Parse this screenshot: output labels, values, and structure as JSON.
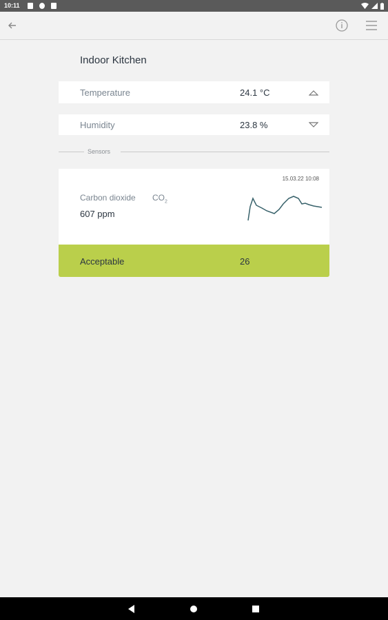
{
  "status_bar": {
    "time": "10:11",
    "left_icons": [
      "notification-icon",
      "sync-icon",
      "sd-card-icon"
    ],
    "right_icons": [
      "wifi-icon",
      "signal-icon",
      "battery-icon"
    ]
  },
  "toolbar": {
    "back_icon": "back-arrow-icon",
    "info_icon": "info-icon",
    "menu_icon": "menu-icon"
  },
  "page": {
    "title": "Indoor Kitchen"
  },
  "readings": [
    {
      "label": "Temperature",
      "value": "24.1 °C",
      "caret": "caret-up-icon"
    },
    {
      "label": "Humidity",
      "value": "23.8 %",
      "caret": "caret-down-icon"
    }
  ],
  "section": {
    "label": "Sensors"
  },
  "sensor": {
    "timestamp": "15.03.22 10:08",
    "name": "Carbon dioxide",
    "symbol_main": "CO",
    "symbol_sub": "2",
    "value": "607 ppm",
    "sparkline_color": "#37616a"
  },
  "status": {
    "label": "Acceptable",
    "value": "26",
    "color": "#bacf4b"
  },
  "nav": {
    "icons": [
      "back-triangle-icon",
      "home-circle-icon",
      "recents-square-icon"
    ]
  }
}
